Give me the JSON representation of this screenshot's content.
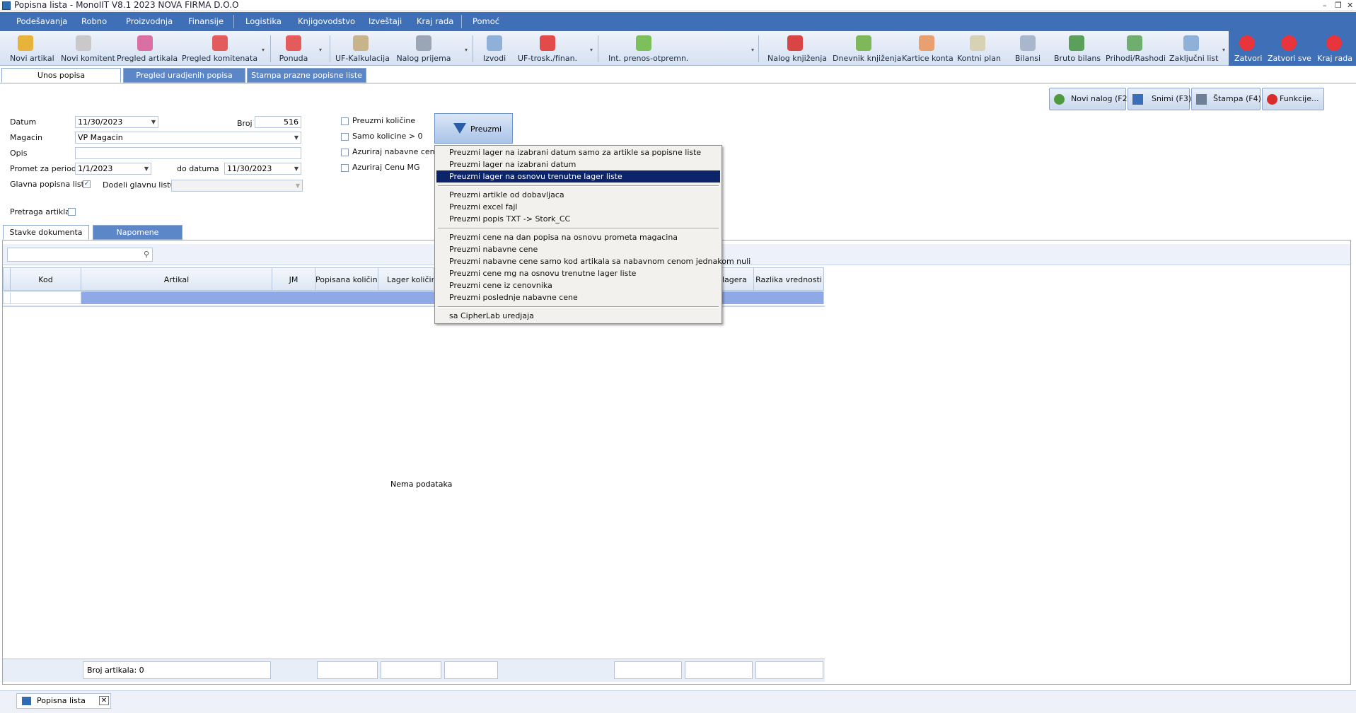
{
  "window": {
    "title": "Popisna lista - MonoIIT V8.1 2023 NOVA FIRMA D.O.O"
  },
  "menu": [
    "Podešavanja",
    "Robno",
    "Proizvodnja",
    "Finansije",
    "Logistika",
    "Knjigovodstvo",
    "Izveštaji",
    "Kraj rada",
    "Pomoć"
  ],
  "toolbar": [
    {
      "label": "Novi artikal",
      "icon": "new-article-icon",
      "color": "#e8b33a"
    },
    {
      "label": "Novi komitent",
      "icon": "new-partner-icon",
      "color": "#c9c9c9"
    },
    {
      "label": "Pregled artikala",
      "icon": "article-list-icon",
      "color": "#d96fa3"
    },
    {
      "label": "Pregled komitenata",
      "icon": "partner-list-icon",
      "color": "#e35b5b"
    },
    {
      "label": "Ponuda",
      "icon": "offer-icon",
      "color": "#e35b5b"
    },
    {
      "label": "UF-Kalkulacija",
      "icon": "calculation-icon",
      "color": "#c8b48a"
    },
    {
      "label": "Nalog prijema",
      "icon": "receipt-icon",
      "color": "#9aa6b5"
    },
    {
      "label": "Izvodi",
      "icon": "statement-icon",
      "color": "#8fb1d9"
    },
    {
      "label": "UF-trosk./finan.",
      "icon": "cost-icon",
      "color": "#e34b4b"
    },
    {
      "label": "Int. prenos-otpremn.",
      "icon": "transfer-icon",
      "color": "#7dbf5a"
    },
    {
      "label": "Nalog knjiženja",
      "icon": "posting-icon",
      "color": "#d94545"
    },
    {
      "label": "Dnevnik knjiženja",
      "icon": "journal-icon",
      "color": "#7fb85a"
    },
    {
      "label": "Kartice konta",
      "icon": "account-card-icon",
      "color": "#e8a070"
    },
    {
      "label": "Kontni plan",
      "icon": "chart-of-accounts-icon",
      "color": "#d8d2b5"
    },
    {
      "label": "Bilansi",
      "icon": "balance-icon",
      "color": "#a9b7cc"
    },
    {
      "label": "Bruto bilans",
      "icon": "gross-balance-icon",
      "color": "#5aa05a"
    },
    {
      "label": "Prihodi/Rashodi",
      "icon": "income-expense-icon",
      "color": "#6fae6f"
    },
    {
      "label": "Zaključni list",
      "icon": "closing-sheet-icon",
      "color": "#8fb1d9"
    },
    {
      "label": "Zatvori",
      "icon": "close-icon",
      "color": "#e8343c"
    },
    {
      "label": "Zatvori sve",
      "icon": "close-all-icon",
      "color": "#e8343c"
    },
    {
      "label": "Kraj rada",
      "icon": "power-icon",
      "color": "#e8343c"
    }
  ],
  "page_tabs": [
    "Unos popisa",
    "Pregled uradjenih popisa",
    "Stampa prazne popisne liste"
  ],
  "actions": {
    "new": "Novi nalog (F2)",
    "save": "Snimi (F3)",
    "print": "Štampa (F4)",
    "functions": "Funkcije..."
  },
  "form": {
    "datum_label": "Datum",
    "datum": "11/30/2023",
    "broj_label": "Broj",
    "broj": "516",
    "magacin_label": "Magacin",
    "magacin": "VP Magacin",
    "opis_label": "Opis",
    "opis": "",
    "promet_label": "Promet za period",
    "promet_od": "1/1/2023",
    "do_label": "do datuma",
    "promet_do": "11/30/2023",
    "glavna_label": "Glavna popisna lista",
    "glavna_checked": true,
    "dodeli_label": "Dodeli glavnu listu",
    "pretraga_label": "Pretraga artikla"
  },
  "options": [
    "Preuzmi količine",
    "Samo kolicine > 0",
    "Azuriraj nabavne cene",
    "Azuriraj Cenu MG"
  ],
  "preuzmi_label": "Preuzmi",
  "dropdown": {
    "group1": [
      "Preuzmi lager na izabrani datum samo za artikle sa popisne liste",
      "Preuzmi lager na izabrani datum",
      "Preuzmi lager na osnovu trenutne lager liste"
    ],
    "group2": [
      "Preuzmi artikle od dobavljaca",
      "Preuzmi excel fajl",
      "Preuzmi popis TXT -> Stork_CC"
    ],
    "group3": [
      "Preuzmi cene na dan popisa na osnovu prometa magacina",
      "Preuzmi nabavne cene",
      "Preuzmi nabavne cene samo kod artikala sa nabavnom cenom jednakom nuli",
      "Preuzmi cene mg na osnovu trenutne lager liste",
      "Preuzmi cene iz cenovnika",
      "Preuzmi poslednje nabavne cene"
    ],
    "group4": [
      "sa CipherLab uredjaja"
    ],
    "highlighted": "Preuzmi lager na osnovu trenutne lager liste"
  },
  "inner_tabs": [
    "Stavke dokumenta",
    "Napomene"
  ],
  "search": {
    "placeholder": ""
  },
  "grid": {
    "columns": [
      "Kod",
      "Artikal",
      "JM",
      "Popisana količina",
      "Lager količina",
      "lagera",
      "Razlika vrednosti"
    ],
    "empty_text": "Nema podataka"
  },
  "footer": {
    "count": "Broj artikala: 0"
  },
  "statusbar": {
    "doc_tab": "Popisna lista"
  }
}
